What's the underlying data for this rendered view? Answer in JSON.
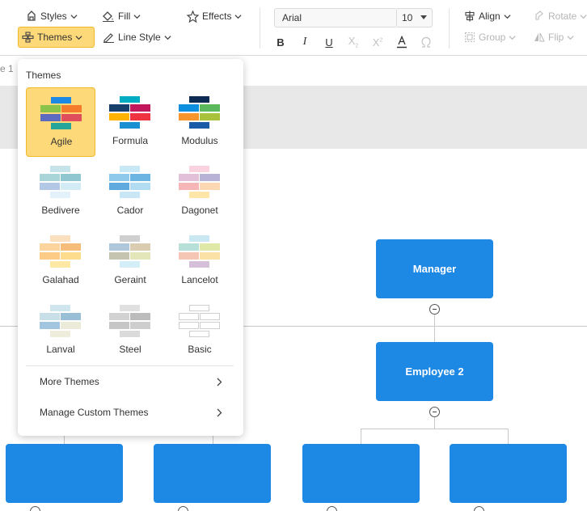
{
  "toolbar": {
    "styles": "Styles",
    "fill": "Fill",
    "effects": "Effects",
    "themes": "Themes",
    "line_style": "Line Style",
    "font_family": "Arial",
    "font_size": "10",
    "align": "Align",
    "rotate": "Rotate",
    "group": "Group",
    "flip": "Flip",
    "format_buttons": [
      "bold-icon",
      "italic-icon",
      "underline-icon",
      "subscript-icon",
      "superscript-icon",
      "text-color-icon",
      "special-character-icon"
    ]
  },
  "canvas": {
    "page_tab": "e 1",
    "nodes": {
      "manager": "Manager",
      "employee2": "Employee 2"
    },
    "colors": {
      "node": "#1e88e5",
      "page_strip": "#e8e8e8"
    }
  },
  "themes_panel": {
    "title": "Themes",
    "selected": "Agile",
    "selected_color": "#fed97a",
    "themes": [
      {
        "name": "Agile",
        "colors": [
          "#1e88e5",
          "#8bc34a",
          "#f57c2a",
          "#5c6bc0",
          "#e04e5e",
          "#26a69a"
        ]
      },
      {
        "name": "Formula",
        "colors": [
          "#00acc1",
          "#173f6b",
          "#c2185b",
          "#ffb300",
          "#ef3340",
          "#1a8fd1"
        ]
      },
      {
        "name": "Modulus",
        "colors": [
          "#0d2c54",
          "#0d8fe0",
          "#5cb85c",
          "#f7942b",
          "#a8c23b",
          "#1a5aa6"
        ]
      },
      {
        "name": "Bedivere",
        "colors": [
          "#c5e3e8",
          "#a9d5d8",
          "#8fc6cf",
          "#b3c8e6",
          "#d3ebf5",
          "#e3f2fa"
        ]
      },
      {
        "name": "Cador",
        "colors": [
          "#c9e8f5",
          "#8ec9eb",
          "#6cb5e3",
          "#5ea9dd",
          "#b1dcf2",
          "#c8e6f5"
        ]
      },
      {
        "name": "Dagonet",
        "colors": [
          "#f9d3df",
          "#e2c0d9",
          "#b7b2d6",
          "#f6b6b8",
          "#fbd7b2",
          "#fde6a8"
        ]
      },
      {
        "name": "Galahad",
        "colors": [
          "#fbe0c0",
          "#fbd39c",
          "#f7bd7a",
          "#fccb85",
          "#fddc8e",
          "#fde9a3"
        ]
      },
      {
        "name": "Geraint",
        "colors": [
          "#cfcfcf",
          "#aec7db",
          "#d9ccb0",
          "#c5c4b1",
          "#e2e6b9",
          "#d3eef7"
        ]
      },
      {
        "name": "Lancelot",
        "colors": [
          "#c9e8f1",
          "#b7e0d9",
          "#dfe8a6",
          "#f6c6b5",
          "#fce1a6",
          "#d6c0d9"
        ]
      },
      {
        "name": "Lanval",
        "colors": [
          "#d0e6ef",
          "#c9dfe8",
          "#99bfd6",
          "#a3c6e0",
          "#ecead9",
          "#eeeddc"
        ]
      },
      {
        "name": "Steel",
        "colors": [
          "#e0e0e0",
          "#d2d2d2",
          "#bcbcbc",
          "#c6c6c6",
          "#cecece",
          "#dadada"
        ]
      },
      {
        "name": "Basic",
        "colors": [
          "#ffffff",
          "#ffffff",
          "#ffffff",
          "#ffffff",
          "#ffffff",
          "#ffffff"
        ]
      }
    ],
    "more_themes": "More Themes",
    "manage_custom_themes": "Manage Custom Themes"
  }
}
